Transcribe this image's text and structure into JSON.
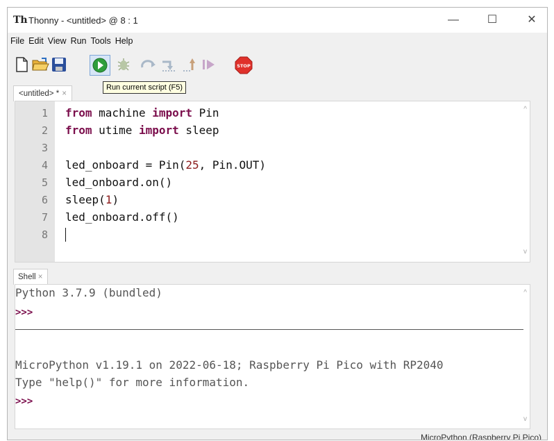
{
  "window": {
    "app_icon": "Th",
    "title": "Thonny - <untitled> @ 8 : 1",
    "minimize": "—",
    "maximize": "☐",
    "close": "✕"
  },
  "menu": [
    "File",
    "Edit",
    "View",
    "Run",
    "Tools",
    "Help"
  ],
  "toolbar": {
    "icons": [
      "new-file-icon",
      "open-folder-icon",
      "save-icon",
      "run-icon",
      "debug-icon",
      "step-over-icon",
      "step-into-icon",
      "step-out-icon",
      "resume-icon",
      "stop-icon"
    ],
    "stop_label": "STOP",
    "tooltip": "Run current script (F5)"
  },
  "editor": {
    "tab_label": "<untitled> *",
    "tab_close": "×",
    "line_numbers": [
      "1",
      "2",
      "3",
      "4",
      "5",
      "6",
      "7",
      "8"
    ],
    "lines": [
      {
        "kw1": "from",
        "t1": " machine ",
        "kw2": "import",
        "t2": " Pin"
      },
      {
        "kw1": "from",
        "t1": " utime ",
        "kw2": "import",
        "t2": " sleep"
      },
      {
        "text": ""
      },
      {
        "pre": "led_onboard = Pin(",
        "num": "25",
        "post": ", Pin.OUT)"
      },
      {
        "text": "led_onboard.on()"
      },
      {
        "pre": "sleep(",
        "num": "1",
        "post": ")"
      },
      {
        "text": "led_onboard.off()"
      },
      {
        "text": ""
      }
    ],
    "scroll_up": "^",
    "scroll_down": "v"
  },
  "shell": {
    "tab_label": "Shell",
    "tab_close": "×",
    "line1": "Python 3.7.9 (bundled)",
    "prompt1": ">>>",
    "line2": "MicroPython v1.19.1 on 2022-06-18; Raspberry Pi Pico with RP2040",
    "line3": "Type \"help()\" for more information.",
    "prompt2": ">>>",
    "scroll_up": "^",
    "scroll_down": "v"
  },
  "status": {
    "interpreter": "MicroPython (Raspberry Pi Pico)"
  }
}
